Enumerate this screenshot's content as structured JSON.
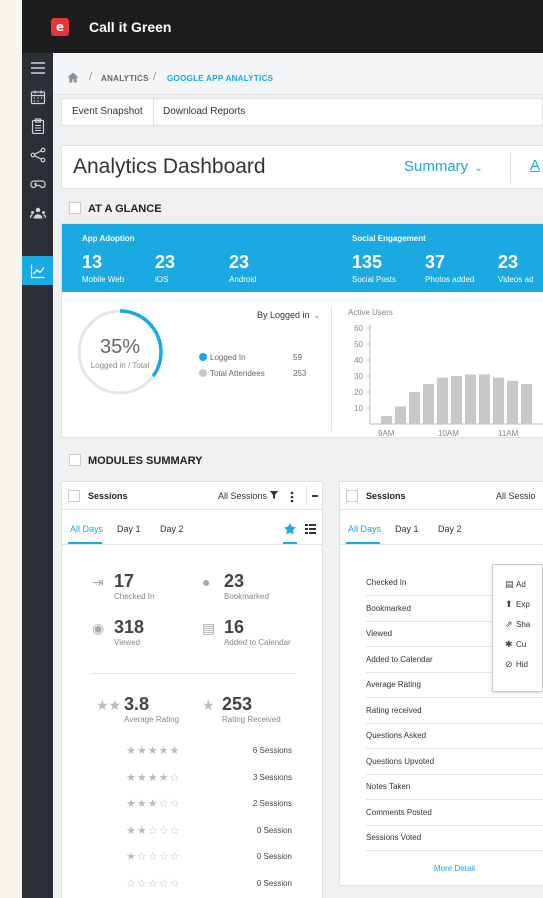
{
  "app": {
    "title": "Call it Green",
    "logo_letter": "e"
  },
  "sidebar": {
    "items": [
      {
        "icon": "menu-icon"
      },
      {
        "icon": "calendar-icon"
      },
      {
        "icon": "clipboard-icon"
      },
      {
        "icon": "share-icon"
      },
      {
        "icon": "gamepad-icon"
      },
      {
        "icon": "people-icon"
      },
      {
        "icon": "analytics-icon",
        "active": true
      }
    ]
  },
  "breadcrumb": {
    "items": [
      "ANALYTICS",
      "GOOGLE APP ANALYTICS"
    ],
    "separator": "/"
  },
  "subtabs": [
    "Event Snapshot",
    "Download Reports"
  ],
  "dashboard": {
    "title": "Analytics Dashboard",
    "view_select": "Summary",
    "next_tab_partial": "A"
  },
  "at_a_glance": {
    "title": "AT A GLANCE",
    "app_adoption": {
      "heading": "App Adoption",
      "stats": [
        {
          "value": "13",
          "label": "Mobile Web"
        },
        {
          "value": "23",
          "label": "iOS"
        },
        {
          "value": "23",
          "label": "Android"
        }
      ]
    },
    "social_engagement": {
      "heading": "Social Engagement",
      "stats": [
        {
          "value": "135",
          "label": "Social Posts"
        },
        {
          "value": "37",
          "label": "Photos added"
        },
        {
          "value": "23",
          "label": "Videos ad"
        }
      ]
    },
    "logged_in": {
      "percent": "35%",
      "fraction": 0.35,
      "label": "Logged in / Total",
      "filter": "By Logged in",
      "legend": [
        {
          "label": "Logged In",
          "value": "59",
          "color": "#1aa9e1"
        },
        {
          "label": "Total Attendees",
          "value": "253",
          "color": "#c8c8c8"
        }
      ]
    }
  },
  "chart_data": {
    "type": "bar",
    "title": "Active Users",
    "xlabel": "",
    "ylabel": "",
    "ylim": [
      0,
      60
    ],
    "yticks": [
      10,
      20,
      30,
      40,
      50,
      60
    ],
    "xticks": [
      "9AM",
      "10AM",
      "11AM"
    ],
    "values": [
      5,
      11,
      20,
      25,
      29,
      30,
      31,
      31,
      29,
      27,
      25
    ],
    "grid": false
  },
  "modules": {
    "title": "MODULES SUMMARY",
    "card_left": {
      "title": "Sessions",
      "filter": "All Sessions",
      "day_tabs": [
        "All Days",
        "Day 1",
        "Day 2"
      ],
      "stats": [
        {
          "value": "17",
          "label": "Checked In",
          "icon": "checkin-icon"
        },
        {
          "value": "23",
          "label": "Bookmarked",
          "icon": "bookmark-icon"
        },
        {
          "value": "318",
          "label": "Viewed",
          "icon": "eye-icon"
        },
        {
          "value": "16",
          "label": "Added to Calendar",
          "icon": "calendar-icon"
        }
      ],
      "rating": {
        "value": "3.8",
        "label": "Average Rating",
        "received": "253",
        "received_label": "Rating Received"
      },
      "star_breakdown": [
        {
          "stars": 5,
          "count": "6 Sessions"
        },
        {
          "stars": 4,
          "count": "3 Sessions"
        },
        {
          "stars": 3,
          "count": "2 Sessions"
        },
        {
          "stars": 2,
          "count": "0 Session"
        },
        {
          "stars": 1,
          "count": "0 Session"
        },
        {
          "stars": 0,
          "count": "0 Session"
        }
      ]
    },
    "card_right": {
      "title": "Sessions",
      "filter": "All Sessio",
      "day_tabs": [
        "All Days",
        "Day 1",
        "Day 2"
      ],
      "rows": [
        "Checked In",
        "Bookmarked",
        "Viewed",
        "Added to Calendar",
        "Average Rating",
        "Rating received",
        "Questions Asked",
        "Questions Upvoted",
        "Notes Taken",
        "Comments Posted",
        "Sessions Voted"
      ],
      "more": "More Detail"
    },
    "dropdown": [
      "Ad",
      "Exp",
      "Sha",
      "Cu",
      "Hid"
    ]
  }
}
